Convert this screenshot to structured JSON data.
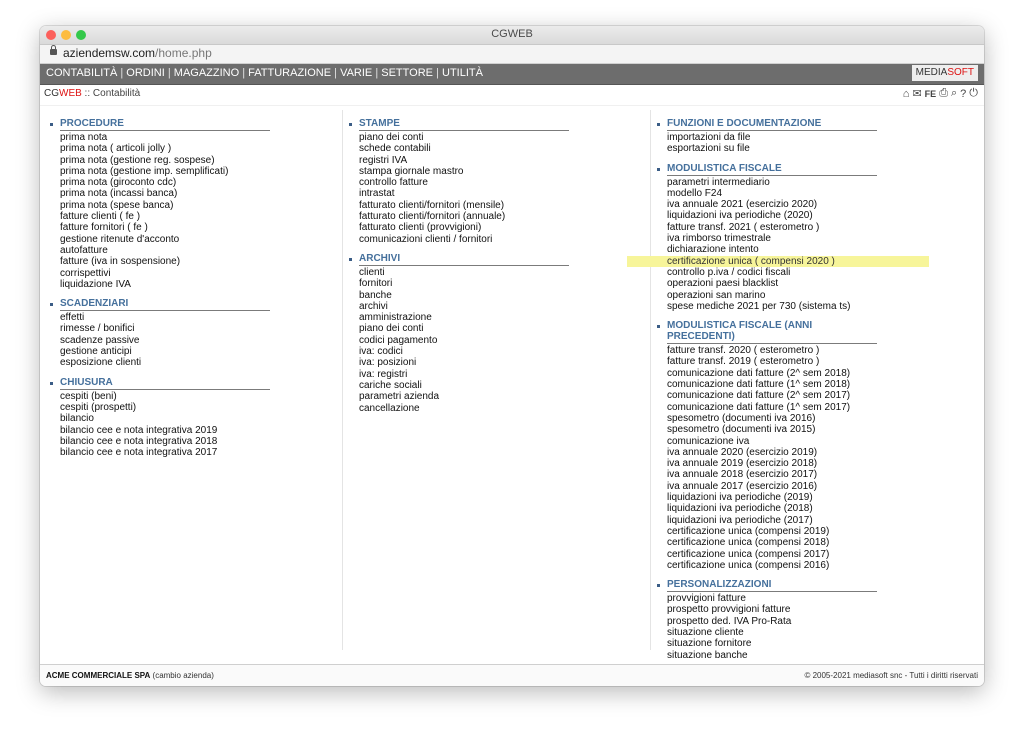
{
  "window": {
    "title": "CGWEB"
  },
  "url": {
    "domain": "aziendemsw.com",
    "path": "/home.php"
  },
  "menu": [
    "CONTABILITÀ",
    "ORDINI",
    "MAGAZZINO",
    "FATTURAZIONE",
    "VARIE",
    "SETTORE",
    "UTILITÀ"
  ],
  "brand": {
    "part1": "MEDIA",
    "part2": "SOFT"
  },
  "breadcrumb": {
    "cg": "CG",
    "web": "WEB",
    "sep": " :: ",
    "page": "Contabilità"
  },
  "toolbar": {
    "fe_label": "FE"
  },
  "columns": [
    [
      {
        "title": "PROCEDURE",
        "items": [
          "prima nota",
          "prima nota ( articoli jolly )",
          "prima nota (gestione reg. sospese)",
          "prima nota (gestione imp. semplificati)",
          "prima nota (giroconto cdc)",
          "prima nota (incassi banca)",
          "prima nota (spese banca)",
          "fatture clienti ( fe )",
          "fatture fornitori ( fe )",
          "gestione ritenute d'acconto",
          "autofatture",
          "fatture (iva in sospensione)",
          "corrispettivi",
          "liquidazione IVA"
        ]
      },
      {
        "title": "SCADENZIARI",
        "items": [
          "effetti",
          "rimesse / bonifici",
          "scadenze passive",
          "gestione anticipi",
          "esposizione clienti"
        ]
      },
      {
        "title": "CHIUSURA",
        "items": [
          "cespiti (beni)",
          "cespiti (prospetti)",
          "bilancio",
          "bilancio cee e nota integrativa 2019",
          "bilancio cee e nota integrativa 2018",
          "bilancio cee e nota integrativa 2017"
        ]
      }
    ],
    [
      {
        "title": "STAMPE",
        "items": [
          "piano dei conti",
          "schede contabili",
          "registri IVA",
          "stampa giornale mastro",
          "controllo fatture",
          "intrastat",
          "fatturato clienti/fornitori (mensile)",
          "fatturato clienti/fornitori (annuale)",
          "fatturato clienti (provvigioni)",
          "comunicazioni clienti / fornitori"
        ]
      },
      {
        "title": "ARCHIVI",
        "items": [
          "clienti",
          "fornitori",
          "banche",
          "archivi",
          "amministrazione",
          "piano dei conti",
          "codici pagamento",
          "iva: codici",
          "iva: posizioni",
          "iva: registri",
          "cariche sociali",
          "parametri azienda",
          "cancellazione"
        ]
      }
    ],
    [
      {
        "title": "FUNZIONI E DOCUMENTAZIONE",
        "items": [
          "importazioni da file",
          "esportazioni su file"
        ]
      },
      {
        "title": "MODULISTICA FISCALE",
        "items": [
          "parametri intermediario",
          "modello F24",
          "iva annuale 2021 (esercizio 2020)",
          "liquidazioni iva periodiche (2020)",
          "fatture transf. 2021 ( esterometro )",
          "iva rimborso trimestrale",
          "dichiarazione intento",
          "certificazione unica ( compensi 2020 )",
          "controllo p.iva / codici fiscali",
          "operazioni paesi blacklist",
          "operazioni san marino",
          "spese mediche 2021 per 730 (sistema ts)"
        ],
        "highlight": 7
      },
      {
        "title": "MODULISTICA FISCALE (ANNI PRECEDENTI)",
        "items": [
          "fatture transf. 2020 ( esterometro )",
          "fatture transf. 2019 ( esterometro )",
          "comunicazione dati fatture (2^ sem 2018)",
          "comunicazione dati fatture (1^ sem 2018)",
          "comunicazione dati fatture (2^ sem 2017)",
          "comunicazione dati fatture (1^ sem 2017)",
          "spesometro (documenti iva 2016)",
          "spesometro (documenti iva 2015)",
          "comunicazione iva",
          "iva annuale 2020 (esercizio 2019)",
          "iva annuale 2019 (esercizio 2018)",
          "iva annuale 2018 (esercizio 2017)",
          "iva annuale 2017 (esercizio 2016)",
          "liquidazioni iva periodiche (2019)",
          "liquidazioni iva periodiche (2018)",
          "liquidazioni iva periodiche (2017)",
          "certificazione unica (compensi 2019)",
          "certificazione unica (compensi 2018)",
          "certificazione unica (compensi 2017)",
          "certificazione unica (compensi 2016)"
        ]
      },
      {
        "title": "PERSONALIZZAZIONI",
        "items": [
          "provvigioni fatture",
          "prospetto provvigioni fatture",
          "prospetto ded. IVA Pro-Rata",
          "situazione cliente",
          "situazione fornitore",
          "situazione banche"
        ]
      }
    ]
  ],
  "footer": {
    "company": "ACME COMMERCIALE SPA",
    "change": "(cambio azienda)",
    "copyright": "© 2005-2021 mediasoft snc - Tutti i diritti riservati"
  },
  "colors": {
    "menubar": "#6d6d6d",
    "section_title": "#45709c",
    "highlight": "#f7f59a",
    "brand_accent": "#dd1111"
  }
}
